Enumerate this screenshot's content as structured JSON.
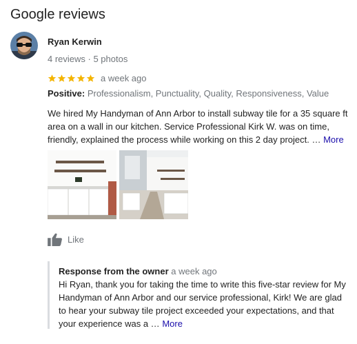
{
  "section_title": "Google reviews",
  "review": {
    "author": "Ryan Kerwin",
    "author_meta": "4 reviews · 5 photos",
    "stars": 5,
    "time": "a week ago",
    "positive_label": "Positive:",
    "positive_values": "Professionalism, Punctuality, Quality, Responsiveness, Value",
    "text": "We hired My Handyman of Ann Arbor to install subway tile for a 35 square ft area on a wall in our kitchen. Service Professional Kirk W. was on time, friendly, explained the process while working on this 2 day project. …",
    "more_label": "More",
    "like_label": "Like"
  },
  "owner_response": {
    "heading": "Response from the owner",
    "time": "a week ago",
    "text": "Hi Ryan, thank you for taking the time to write this five-star review for My Handyman of Ann Arbor and our service professional, Kirk! We are glad to hear your subway tile project exceeded your expectations, and that your experience was a …",
    "more_label": "More"
  },
  "colors": {
    "star": "#f4b400",
    "link": "#1a0dab",
    "secondary_text": "#70757a"
  }
}
